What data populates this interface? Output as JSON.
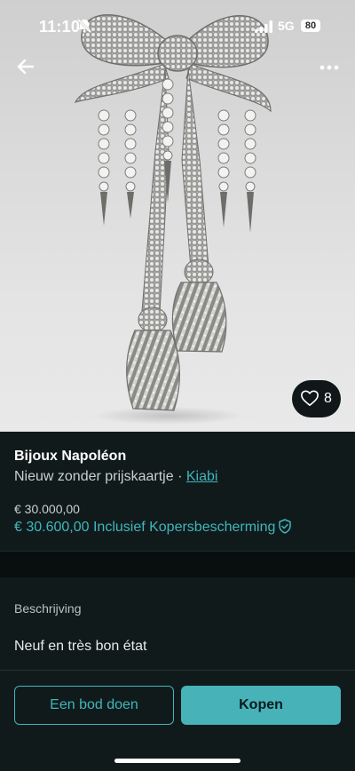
{
  "status_bar": {
    "time": "11:10",
    "network": "5G",
    "battery": "80",
    "icons": [
      "bell-slash-icon",
      "signal-icon",
      "battery-icon"
    ]
  },
  "header": {
    "back_icon": "arrow-left-icon",
    "more_icon": "more-horizontal-icon"
  },
  "product_image": {
    "subject": "diamond-bow-brooch-with-tassels"
  },
  "favorites": {
    "icon": "heart-icon",
    "count": "8"
  },
  "product": {
    "title": "Bijoux Napoléon",
    "condition": "Nieuw zonder prijskaartje",
    "separator": " · ",
    "brand": "Kiabi",
    "price": "€ 30.000,00",
    "price_with_protection": "€ 30.600,00 Inclusief Kopersbescherming",
    "protection_icon": "shield-check-icon"
  },
  "description": {
    "heading": "Beschrijving",
    "text": "Neuf en très bon état"
  },
  "actions": {
    "bid_label": "Een bod doen",
    "buy_label": "Kopen"
  },
  "colors": {
    "accent": "#47b3b9",
    "background": "#111a1b",
    "link": "#3fb6bd"
  }
}
